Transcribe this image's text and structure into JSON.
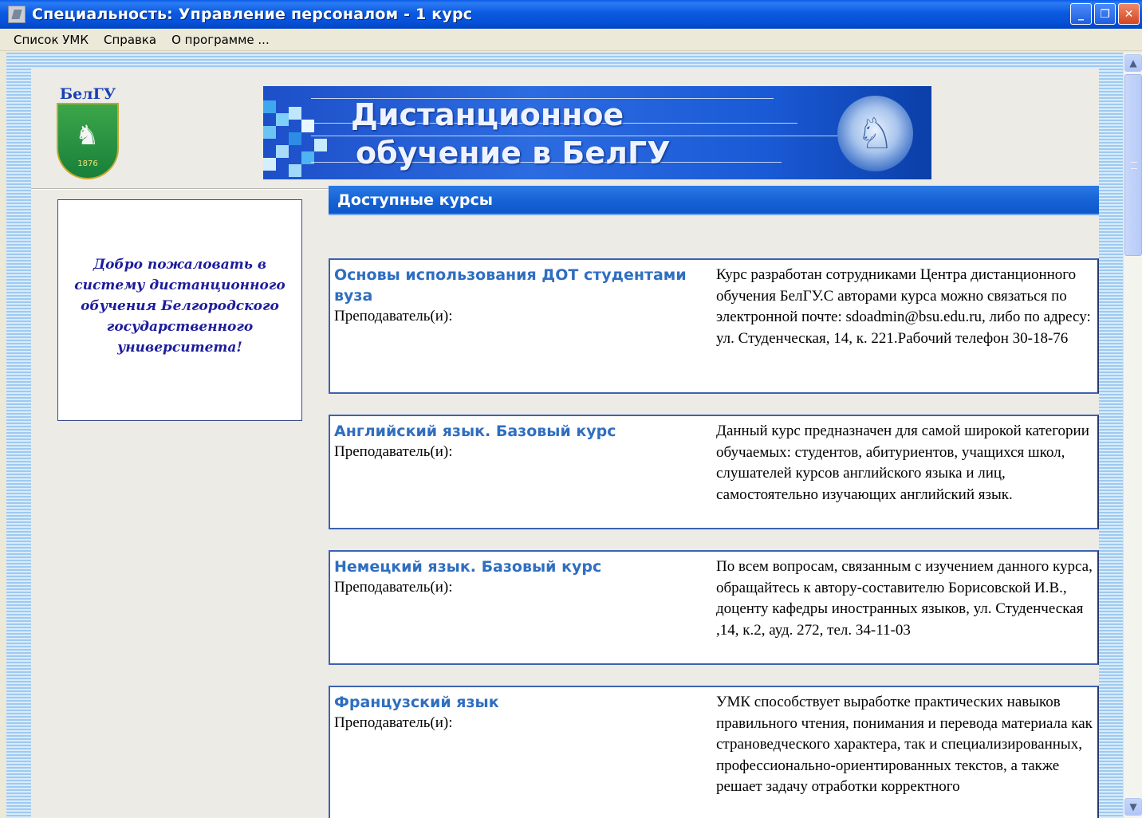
{
  "window": {
    "title": "Специальность: Управление персоналом - 1 курс",
    "buttons": {
      "minimize": "_",
      "maximize": "❐",
      "close": "✕"
    }
  },
  "menu": {
    "items": [
      "Список УМК",
      "Справка",
      "О программе ..."
    ]
  },
  "logo": {
    "text": "БелГУ",
    "year": "1876"
  },
  "banner": {
    "line1": "Дистанционное",
    "line2": "обучение в БелГУ"
  },
  "welcome": {
    "text": "Добро пожаловать в систему дистанционного обучения Белгородского государственного университета!"
  },
  "section": {
    "title": "Доступные курсы"
  },
  "courses": [
    {
      "title": "Основы использования ДОТ студентами вуза",
      "teacher_label": "Преподаватель(и):",
      "description": "Курс разработан сотрудниками Центра дистанционного обучения БелГУ.С авторами курса можно связаться по электронной почте: sdoadmin@bsu.edu.ru, либо по адресу: ул. Студенческая, 14, к. 221.Рабочий телефон 30-18-76"
    },
    {
      "title": "Английский язык. Базовый курс",
      "teacher_label": "Преподаватель(и):",
      "description": "Данный курс предназначен для самой широкой категории обучаемых: студентов, абитуриентов, учащихся школ, слушателей курсов английского языка и лиц, самостоятельно изучающих английский язык."
    },
    {
      "title": "Немецкий язык. Базовый курс",
      "teacher_label": "Преподаватель(и):",
      "description": "По всем вопросам, связанным с изучением данного курса, обращайтесь к автору-составителю Борисовской И.В., доценту кафедры иностранных языков, ул. Студенческая ,14, к.2, ауд. 272, тел. 34-11-03"
    },
    {
      "title": "Французский язык",
      "teacher_label": "Преподаватель(и):",
      "description": "УМК способствует выработке практических навыков правильного чтения, понимания и перевода материала как страноведческого характера, так и специализированных, профессионально-ориентированных текстов, а также решает задачу отработки корректного"
    }
  ],
  "colors": {
    "titlebar": "#0a5ae8",
    "section_header": "#1764d6",
    "course_title": "#2f6ec0",
    "welcome_text": "#1c1c9c",
    "course_border": "#3d62b0"
  },
  "icons": {
    "app": "app-window-icon",
    "scroll_up": "scroll-up-arrow-icon",
    "scroll_down": "scroll-down-arrow-icon"
  }
}
